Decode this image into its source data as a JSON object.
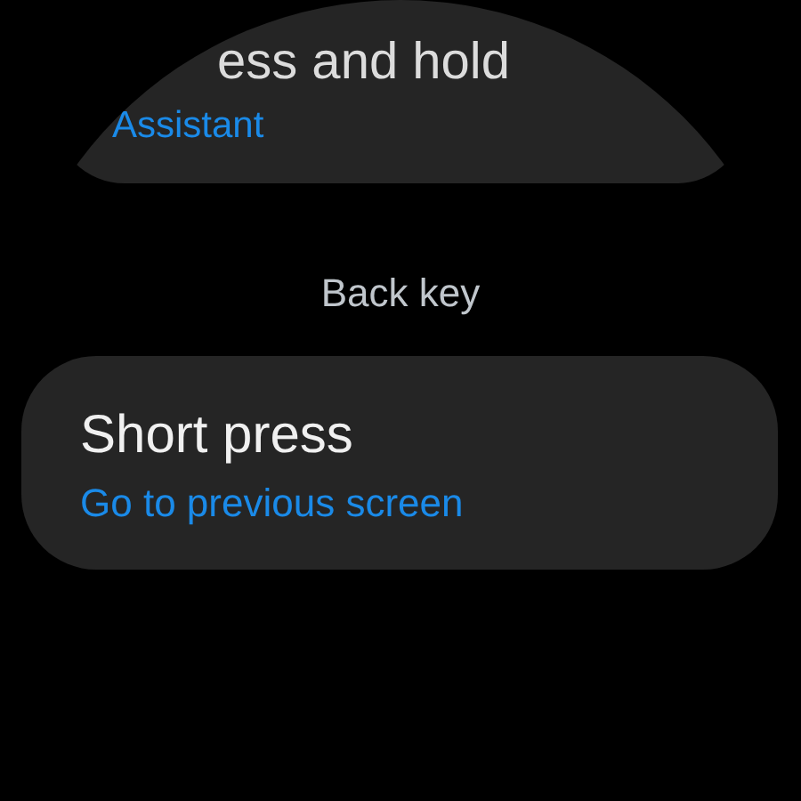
{
  "items": [
    {
      "title": "ess and hold",
      "subtitle": "Assistant"
    }
  ],
  "section_header": "Back key",
  "section_items": [
    {
      "title": "Short press",
      "subtitle": "Go to previous screen"
    }
  ]
}
